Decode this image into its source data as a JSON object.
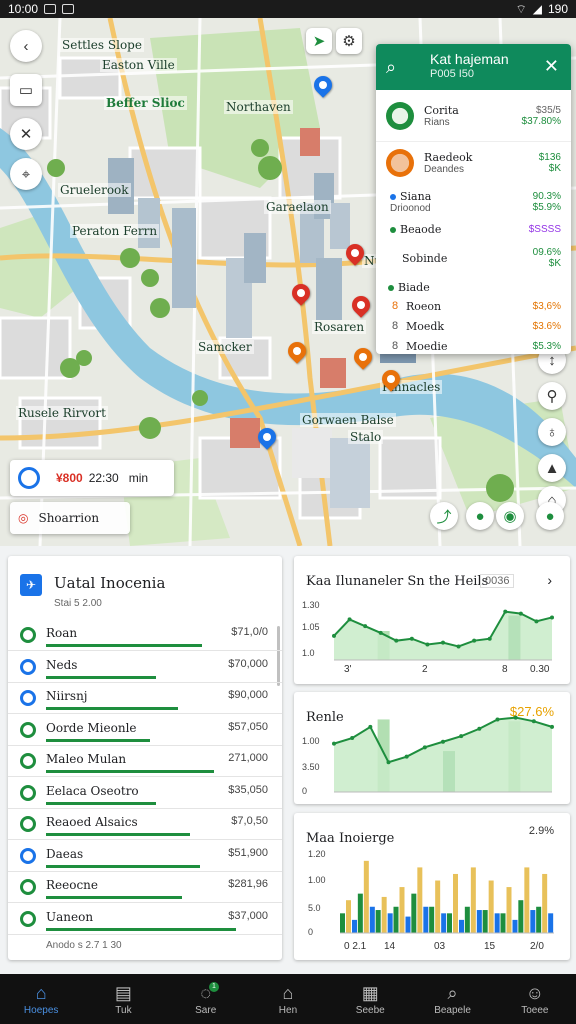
{
  "status_bar": {
    "time": "10:00",
    "right": "190"
  },
  "map": {
    "labels": [
      "Settles Slope",
      "Easton Ville",
      "Beffer Slioc",
      "Northaven",
      "Gruelerook",
      "Peraton Ferrn",
      "Nusiane",
      "Garaelaon",
      "Samcker",
      "Rosaren",
      "Pinnacles",
      "Gorwaen Balse",
      "Rusele Rirvort",
      "Stalo"
    ]
  },
  "search_panel": {
    "title": "Kat hajeman",
    "subtitle": "P005 I50",
    "items": [
      {
        "name": "Corita",
        "sub": "Rians",
        "value1": "$35/5",
        "value2": "$37.80%"
      },
      {
        "name": "Raedeok",
        "sub": "Deandes",
        "value1": "$136",
        "value2": "$K"
      },
      {
        "name": "Siana",
        "sub": "Drioonod",
        "value1": "90.3%",
        "value2": "$5.9%"
      },
      {
        "name": "Beaode",
        "sub": "",
        "value1": "$SSSS",
        "value2": ""
      },
      {
        "name": "Sobinde",
        "sub": "",
        "value1": "09.6%",
        "value2": "$K"
      },
      {
        "name": "Biade",
        "sub": "",
        "value1": "",
        "value2": ""
      },
      {
        "name": "Roeon",
        "sub": "",
        "value1": "$3,6%",
        "value2": ""
      },
      {
        "name": "Moedk",
        "sub": "",
        "value1": "$3.6%",
        "value2": ""
      },
      {
        "name": "Moedie",
        "sub": "",
        "value1": "$5.3%",
        "value2": ""
      }
    ]
  },
  "map_chips": {
    "info_value": "¥800",
    "info_time": "22:30",
    "info_unit": "min",
    "place_label": "Shoarrion"
  },
  "list_card": {
    "title": "Uatal Inocenia",
    "subtitle": "Stai 5 2.00",
    "footer": "Anodo s 2.7 1 30",
    "rows": [
      {
        "name": "Roan",
        "amount": "$71,0/0",
        "fill": 0.78
      },
      {
        "name": "Neds",
        "amount": "$70,000",
        "fill": 0.55
      },
      {
        "name": "Niirsnj",
        "amount": "$90,000",
        "fill": 0.66
      },
      {
        "name": "Oorde Mieonle",
        "amount": "$57,050",
        "fill": 0.52
      },
      {
        "name": "Maleo Mulan",
        "amount": "271,000",
        "fill": 0.84
      },
      {
        "name": "Eelaca Oseotro",
        "amount": "$35,050",
        "fill": 0.55
      },
      {
        "name": "Reaoed Alsaics",
        "amount": "$7,0,50",
        "fill": 0.72
      },
      {
        "name": "Daeas",
        "amount": "$51,900",
        "fill": 0.77
      },
      {
        "name": "Reeocne",
        "amount": "$281,96",
        "fill": 0.68
      },
      {
        "name": "Uaneon",
        "amount": "$37,000",
        "fill": 0.95
      }
    ]
  },
  "chart1": {
    "title": "Kaa Ilunaneler Sn the Heils",
    "badge": "0036",
    "y_ticks": [
      "1.30",
      "1.05",
      "1.0"
    ],
    "x_ticks": [
      "3'",
      "2",
      "8",
      "0.30"
    ]
  },
  "chart2": {
    "title": "Renle",
    "value": "$27.6%",
    "y_ticks": [
      "1.00",
      "3.50",
      "0"
    ]
  },
  "chart3": {
    "title": "Maa Inoierge",
    "value": "2.9%",
    "y_ticks": [
      "1.20",
      "1.00",
      "5.0",
      "0"
    ],
    "x_ticks": [
      "0 2.1",
      "14",
      "03",
      "15",
      "2/0"
    ]
  },
  "chart_data": [
    {
      "type": "area",
      "title": "Kaa Ilunaneler Sn the Heils",
      "x": [
        0,
        1,
        2,
        3,
        4,
        5,
        6,
        7,
        8,
        9,
        10,
        11,
        12,
        13,
        14
      ],
      "series": [
        {
          "values": [
            0.95,
            1.12,
            1.05,
            0.98,
            0.9,
            0.92,
            0.86,
            0.88,
            0.84,
            0.9,
            0.92,
            1.2,
            1.18,
            1.1,
            1.14
          ]
        }
      ],
      "bars": [
        1.0,
        1.16
      ],
      "ylim": [
        0.7,
        1.3
      ],
      "colors": {
        "line": "#1e8e3e",
        "fill": "#c8ebc8"
      }
    },
    {
      "type": "area",
      "title": "Renle",
      "x": [
        0,
        1,
        2,
        3,
        4,
        5,
        6,
        7,
        8,
        9,
        10,
        11,
        12
      ],
      "series": [
        {
          "values": [
            2.6,
            2.9,
            3.5,
            1.6,
            1.9,
            2.4,
            2.7,
            3.0,
            3.4,
            3.9,
            4.0,
            3.8,
            3.5
          ]
        }
      ],
      "bars": [
        3.9,
        2.2,
        3.8
      ],
      "ylim": [
        0,
        4.3
      ],
      "colors": {
        "line": "#1e8e3e",
        "fill": "#c8ebc8"
      }
    },
    {
      "type": "bar",
      "title": "Maa Inoierge",
      "categories": [
        "0 2.1",
        "14",
        "03",
        "15",
        "2/0"
      ],
      "series": [
        {
          "values": [
            0.3,
            0.6,
            0.35,
            0.4,
            0.6,
            0.4,
            0.3,
            0.4,
            0.35,
            0.3,
            0.5,
            0.4
          ],
          "color": "#1e8e3e"
        },
        {
          "values": [
            0.5,
            1.1,
            0.55,
            0.7,
            1.0,
            0.8,
            0.9,
            1.0,
            0.8,
            0.7,
            1.0,
            0.9
          ],
          "color": "#e8c15a"
        },
        {
          "values": [
            0.2,
            0.4,
            0.3,
            0.25,
            0.4,
            0.3,
            0.2,
            0.35,
            0.3,
            0.2,
            0.35,
            0.3
          ],
          "color": "#1a73e8"
        }
      ],
      "ylim": [
        0,
        1.25
      ],
      "colors": {
        "green": "#1e8e3e",
        "yellow": "#e8c15a",
        "blue": "#1a73e8"
      }
    }
  ],
  "bottom_nav": [
    {
      "label": "Hoepes",
      "icon": "home-icon",
      "active": true
    },
    {
      "label": "Tuk",
      "icon": "tray-icon",
      "active": false
    },
    {
      "label": "Sare",
      "icon": "chat-icon",
      "active": false,
      "badge": "1"
    },
    {
      "label": "Hen",
      "icon": "house-icon",
      "active": false
    },
    {
      "label": "Seebe",
      "icon": "grid-icon",
      "active": false
    },
    {
      "label": "Beapele",
      "icon": "search-icon",
      "active": false
    },
    {
      "label": "Toeee",
      "icon": "person-icon",
      "active": false
    }
  ]
}
